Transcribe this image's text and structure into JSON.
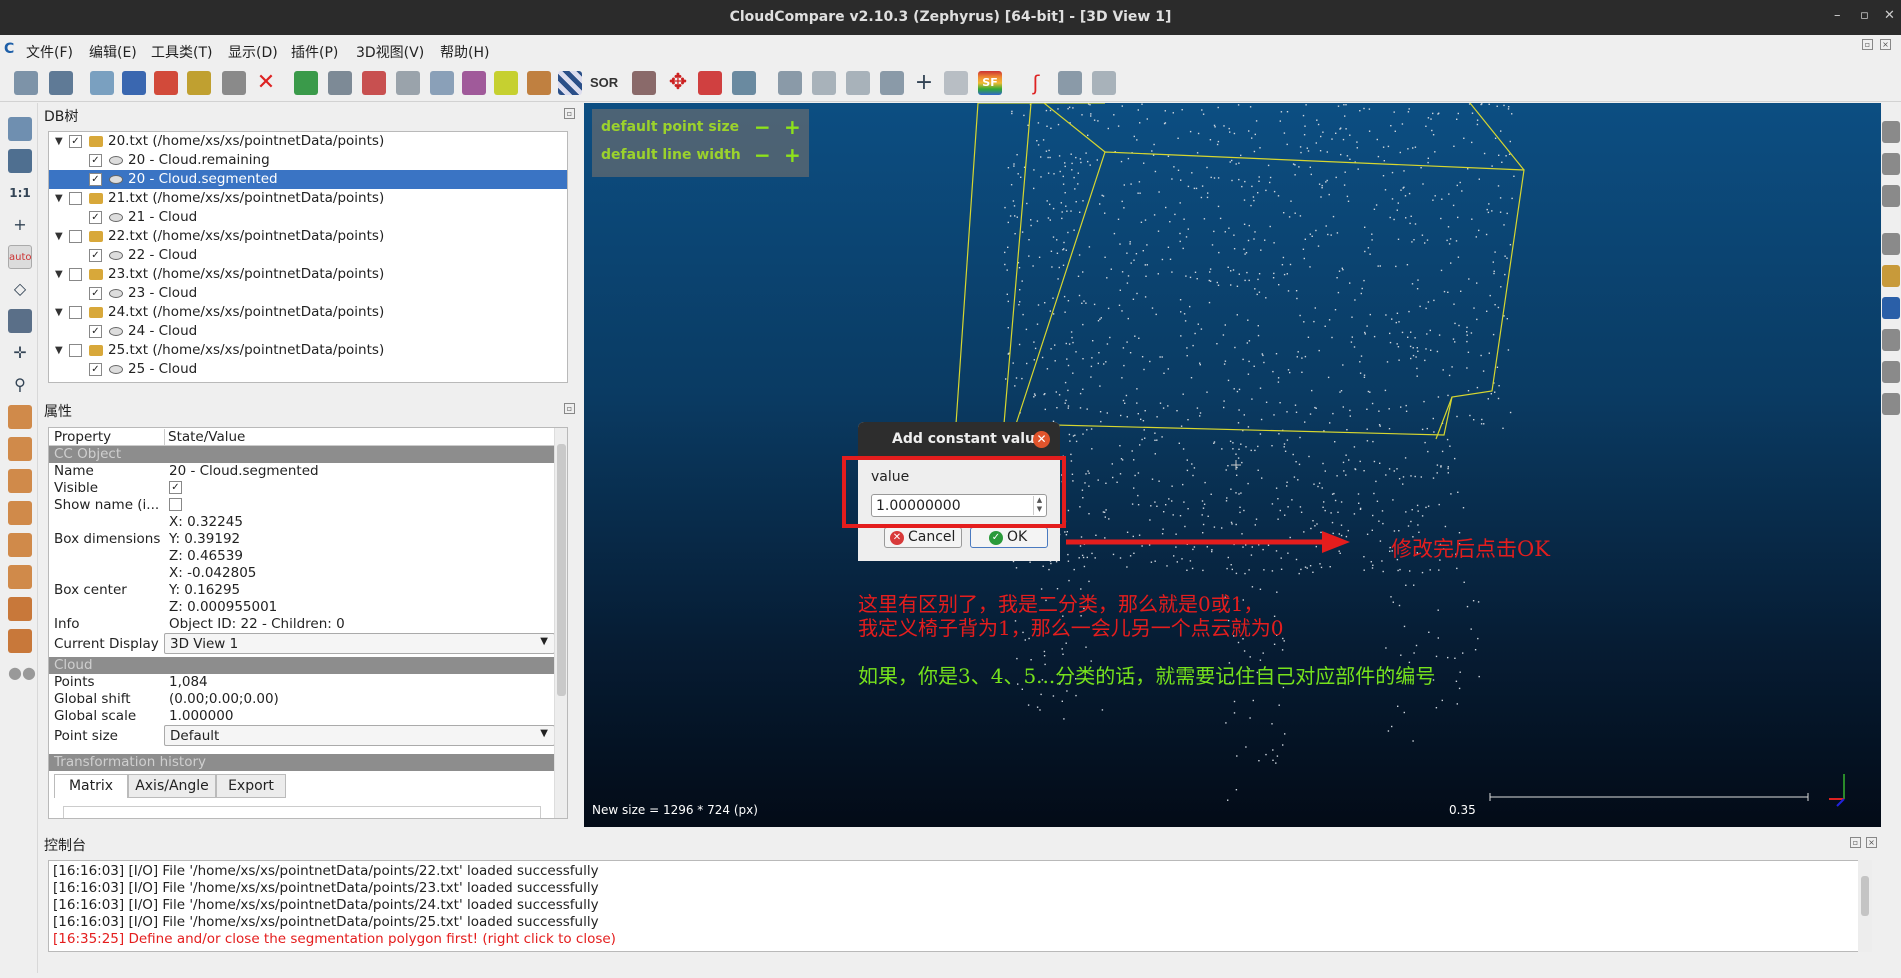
{
  "window": {
    "title": "CloudCompare v2.10.3 (Zephyrus) [64-bit] - [3D View 1]"
  },
  "menu": [
    "文件(F)",
    "编辑(E)",
    "工具类(T)",
    "显示(D)",
    "插件(P)",
    "3D视图(V)",
    "帮助(H)"
  ],
  "toolbar": {
    "sor_label": "SOR",
    "sf_label": "SF"
  },
  "db_tree": {
    "title": "DB树",
    "items": [
      {
        "label": "20.txt (/home/xs/xs/pointnetData/points)",
        "type": "folder",
        "checked": true
      },
      {
        "label": "20 - Cloud.remaining",
        "type": "cloud",
        "checked": true
      },
      {
        "label": "20 - Cloud.segmented",
        "type": "cloud",
        "checked": true,
        "selected": true
      },
      {
        "label": "21.txt (/home/xs/xs/pointnetData/points)",
        "type": "folder",
        "checked": false
      },
      {
        "label": "21 - Cloud",
        "type": "cloud",
        "checked": true
      },
      {
        "label": "22.txt (/home/xs/xs/pointnetData/points)",
        "type": "folder",
        "checked": false
      },
      {
        "label": "22 - Cloud",
        "type": "cloud",
        "checked": true
      },
      {
        "label": "23.txt (/home/xs/xs/pointnetData/points)",
        "type": "folder",
        "checked": false
      },
      {
        "label": "23 - Cloud",
        "type": "cloud",
        "checked": true
      },
      {
        "label": "24.txt (/home/xs/xs/pointnetData/points)",
        "type": "folder",
        "checked": false
      },
      {
        "label": "24 - Cloud",
        "type": "cloud",
        "checked": true
      },
      {
        "label": "25.txt (/home/xs/xs/pointnetData/points)",
        "type": "folder",
        "checked": false
      },
      {
        "label": "25 - Cloud",
        "type": "cloud",
        "checked": true
      }
    ]
  },
  "properties": {
    "title": "属性",
    "header": {
      "property": "Property",
      "value": "State/Value"
    },
    "cc_object_section": "CC Object",
    "name_label": "Name",
    "name_value": "20 - Cloud.segmented",
    "visible_label": "Visible",
    "visible_checked": "✓",
    "show_name_label": "Show name (i...",
    "box_dim_label": "Box dimensions",
    "box_dim_x": "X: 0.32245",
    "box_dim_y": "Y: 0.39192",
    "box_dim_z": "Z: 0.46539",
    "box_center_label": "Box center",
    "box_center_x": "X: -0.042805",
    "box_center_y": "Y: 0.16295",
    "box_center_z": "Z: 0.000955001",
    "info_label": "Info",
    "info_value": "Object ID: 22 - Children: 0",
    "current_display_label": "Current Display",
    "current_display_value": "3D View 1",
    "cloud_section": "Cloud",
    "points_label": "Points",
    "points_value": "1,084",
    "global_shift_label": "Global shift",
    "global_shift_value": "(0.00;0.00;0.00)",
    "global_scale_label": "Global scale",
    "global_scale_value": "1.000000",
    "point_size_label": "Point size",
    "point_size_value": "Default",
    "transformation_section": "Transformation history",
    "tabs": [
      "Matrix",
      "Axis/Angle",
      "Export"
    ]
  },
  "view3d": {
    "hud_point_size": "default point size",
    "hud_line_width": "default line width",
    "hud_minus": "−",
    "hud_plus": "+",
    "new_size": "New size = 1296 * 724 (px)",
    "scale_label": "0.35"
  },
  "dialog": {
    "title": "Add constant value",
    "field_label": "value",
    "field_value": "1.00000000",
    "cancel_label": "Cancel",
    "ok_label": "OK"
  },
  "annotations": {
    "arrow_note": "修改完后点击OK",
    "note_line1": "这里有区别了，我是二分类，那么就是0或1，",
    "note_line2": "我定义椅子背为1，那么一会儿另一个点云就为0",
    "note_line3": "如果，你是3、4、5...分类的话，就需要记住自己对应部件的编号"
  },
  "console": {
    "title": "控制台",
    "lines": [
      {
        "text": "[16:16:03] [I/O] File '/home/xs/xs/pointnetData/points/22.txt' loaded successfully",
        "error": false
      },
      {
        "text": "[16:16:03] [I/O] File '/home/xs/xs/pointnetData/points/23.txt' loaded successfully",
        "error": false
      },
      {
        "text": "[16:16:03] [I/O] File '/home/xs/xs/pointnetData/points/24.txt' loaded successfully",
        "error": false
      },
      {
        "text": "[16:16:03] [I/O] File '/home/xs/xs/pointnetData/points/25.txt' loaded successfully",
        "error": false
      },
      {
        "text": "[16:35:25] Define and/or close the segmentation polygon first! (right click to close)",
        "error": true
      }
    ]
  },
  "colors": {
    "annotation_red": "#e41d1d",
    "annotation_green": "#76e21c",
    "hud_green": "#9bd22c",
    "selection_blue": "#3a74c4"
  }
}
